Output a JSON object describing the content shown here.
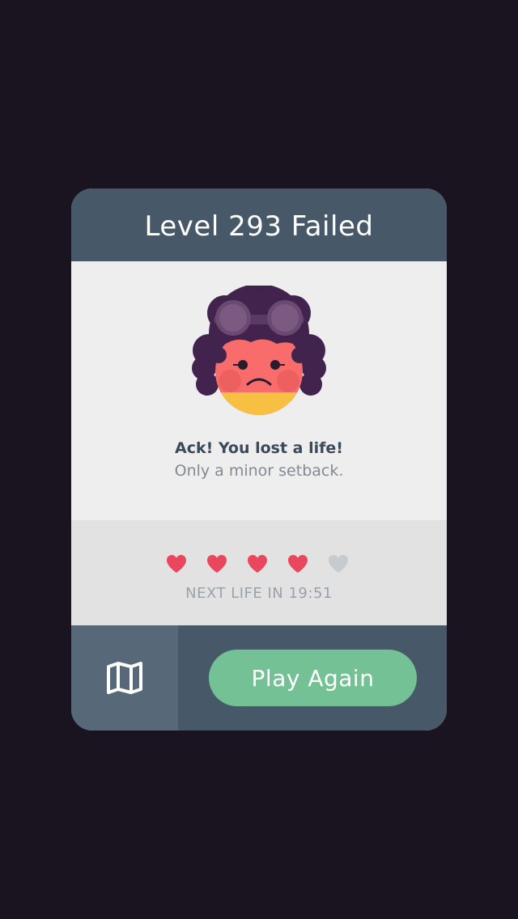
{
  "dialog": {
    "title": "Level 293 Failed",
    "message_primary": "Ack! You lost a life!",
    "message_secondary": "Only a minor setback.",
    "avatar": {
      "icon": "sad-character-with-goggles"
    }
  },
  "lives": {
    "filled": 4,
    "total": 5,
    "next_life_text": "NEXT LIFE IN 19:51",
    "filled_color": "#e8475e",
    "empty_color": "#c6cbd0"
  },
  "footer": {
    "map_icon": "map-icon",
    "play_again_label": "Play Again"
  },
  "colors": {
    "background": "#19141f",
    "header": "#475868",
    "map_button": "#576878",
    "play_button": "#75c196",
    "body": "#eeeeee",
    "lives_band": "#e2e2e2"
  }
}
